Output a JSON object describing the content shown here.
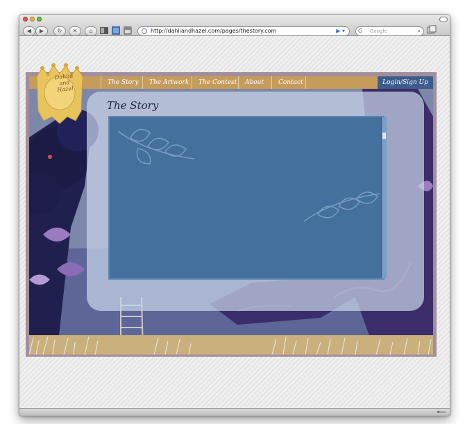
{
  "browser": {
    "url": "http://dahliandhazel.com/pages/thestory.com",
    "search_placeholder": "Google",
    "search_engine_glyph": "G",
    "nav_buttons": {
      "back": "◀",
      "forward": "▶",
      "reload": "↻",
      "stop": "✕",
      "home": "⌂"
    }
  },
  "site": {
    "logo_text": "Dahlia and Hazel",
    "nav": [
      "The Story",
      "The Artwork",
      "The Contest",
      "About",
      "Contact"
    ],
    "login_label": "Login/Sign Up",
    "page_title": "The Story",
    "colors": {
      "nav_bar": "#c69c5a",
      "login_bg": "#3e5c8b",
      "content_bg": "#44709e",
      "frame": "#a28e9c",
      "logo_gold": "#e8c45c"
    }
  },
  "icons": [
    "back-icon",
    "forward-icon",
    "reload-icon",
    "stop-icon",
    "home-icon",
    "bookmarks-icon",
    "rss-icon",
    "search-icon",
    "tab-icon",
    "scroll-thumb"
  ]
}
